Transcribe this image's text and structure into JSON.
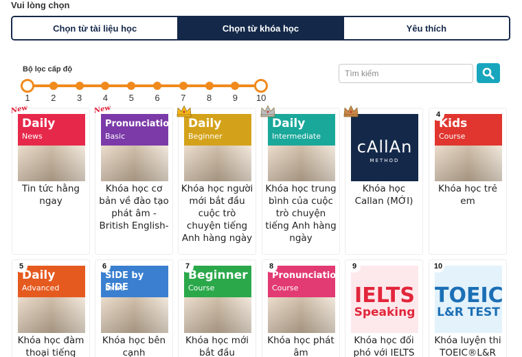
{
  "page_title": "Vui lòng chọn",
  "tabs": [
    {
      "label": "Chọn từ tài liệu học",
      "active": false
    },
    {
      "label": "Chọn từ khóa học",
      "active": true
    },
    {
      "label": "Yêu thích",
      "active": false
    }
  ],
  "filter": {
    "label": "Bộ lọc cấp độ",
    "levels": [
      "1",
      "2",
      "3",
      "4",
      "5",
      "6",
      "7",
      "8",
      "9",
      "10"
    ],
    "selected_min": 1,
    "selected_max": 10,
    "accent": "#f08a1c"
  },
  "search": {
    "placeholder": "Tìm kiếm",
    "value": "",
    "icon": "search-icon"
  },
  "colors": {
    "primary": "#14294a",
    "search_button": "#17a6bd",
    "slider": "#f08a1c"
  },
  "courses": [
    {
      "title": "Tin tức hằng ngay",
      "badge": "New",
      "thumb_title": "Daily",
      "thumb_sub": "News",
      "thumb_color": "#e6294b"
    },
    {
      "title": "Khóa học cơ bản về đào tạo phát âm - British English-",
      "badge": "New",
      "thumb_title": "Pronunciation",
      "thumb_sub": "Basic",
      "thumb_color": "#7b3aa8"
    },
    {
      "title": "Khóa học người mới bắt đầu cuộc trò chuyện tiếng Anh hàng ngày",
      "badge": "crown-gold",
      "thumb_title": "Daily",
      "thumb_sub": "Beginner",
      "thumb_color": "#d4a21a"
    },
    {
      "title": "Khóa học trung bình của cuộc trò chuyện tiếng Anh hàng ngày",
      "badge": "crown-silver",
      "thumb_title": "Daily",
      "thumb_sub": "Intermediate",
      "thumb_color": "#1aa89a"
    },
    {
      "title": "Khóa học Callan (MỚI)",
      "badge": "crown-bronze",
      "thumb_title": "cAllAn",
      "thumb_sub": "METHOD",
      "thumb_color": "#14294a"
    },
    {
      "title": "Khóa học trẻ em",
      "badge": "4",
      "thumb_title": "Kids",
      "thumb_sub": "Course",
      "thumb_color": "#e0362f"
    },
    {
      "title": "Khóa học đàm thoại tiếng",
      "badge": "5",
      "thumb_title": "Daily",
      "thumb_sub": "Advanced",
      "thumb_color": "#e55a1f"
    },
    {
      "title": "Khóa học bên cạnh",
      "badge": "6",
      "thumb_title": "SIDE by SIDE",
      "thumb_sub": "Extra",
      "thumb_color": "#3a7fd0"
    },
    {
      "title": "Khóa học mới bắt đầu",
      "badge": "7",
      "thumb_title": "Beginner",
      "thumb_sub": "Course",
      "thumb_color": "#2aa84a"
    },
    {
      "title": "Khóa học phát âm",
      "badge": "8",
      "thumb_title": "Pronunciation",
      "thumb_sub": "Course",
      "thumb_color": "#e23a72"
    },
    {
      "title": "Khóa học đối phó với IELTS",
      "badge": "9",
      "thumb_title": "IELTS",
      "thumb_sub": "Speaking",
      "thumb_color": "#fde9ec"
    },
    {
      "title": "Khóa luyện thi TOEIC®L&R",
      "badge": "10",
      "thumb_title": "TOEIC®",
      "thumb_sub": "L&R TEST",
      "thumb_color": "#e3f2fb"
    }
  ]
}
